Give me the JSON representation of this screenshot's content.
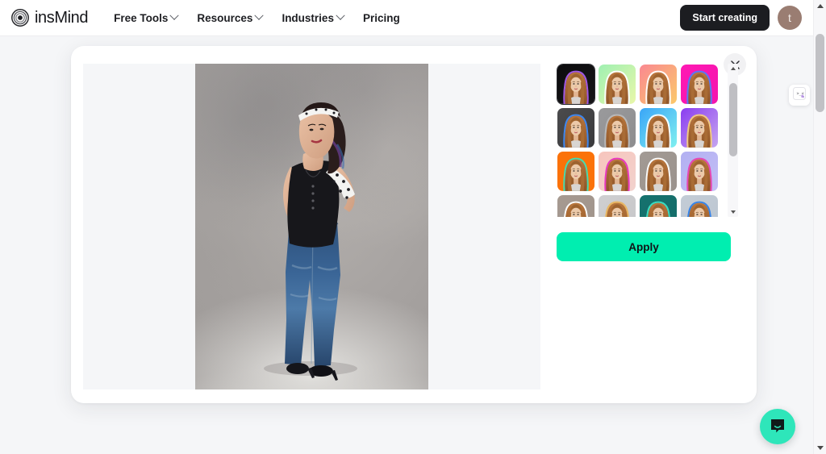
{
  "header": {
    "brand_name": "insMind",
    "logo_icon": "concentric-circles-logo",
    "nav": [
      {
        "label": "Free Tools",
        "has_caret": true
      },
      {
        "label": "Resources",
        "has_caret": true
      },
      {
        "label": "Industries",
        "has_caret": true
      },
      {
        "label": "Pricing",
        "has_caret": false
      }
    ],
    "start_creating_label": "Start creating",
    "avatar_initial": "t",
    "avatar_color": "#9a7d72"
  },
  "modal": {
    "close_icon": "close-icon",
    "canvas": {
      "background": "#f5f6f8",
      "photo_alt": "Full-body studio portrait of a woman in a polka-dot headscarf, black tank top and blue jeans standing against a mottled gray backdrop"
    },
    "style_panel": {
      "apply_label": "Apply",
      "apply_color": "#00eeb0",
      "selected_index": 0,
      "scrollbar": {
        "up_icon": "chevron-up-icon",
        "down_icon": "chevron-down-icon",
        "thumb_position_percent": 7,
        "thumb_size_percent": 55
      },
      "thumbnails": [
        {
          "name": "black-purple-rim",
          "bg": "#0b0b0d",
          "bg2": "#171619",
          "rim": "#a95cf0",
          "selected": true
        },
        {
          "name": "mint-green-gradient",
          "bg": "#9ff0b2",
          "bg2": "#e9f7a9",
          "rim": "#ffffff",
          "selected": false
        },
        {
          "name": "coral-peach-gradient",
          "bg": "#fa8891",
          "bg2": "#fbc96a",
          "rim": "#ffffff",
          "selected": false
        },
        {
          "name": "magenta-blue-rim",
          "bg": "#ff18b4",
          "bg2": "#f315ad",
          "rim": "#4f7dfb",
          "selected": false
        },
        {
          "name": "dark-gray-blue-rim",
          "bg": "#4b4b4d",
          "bg2": "#3a3a3c",
          "rim": "#3d8bfb",
          "selected": false
        },
        {
          "name": "medium-gray",
          "bg": "#9a9a9c",
          "bg2": "#8d8d8f",
          "rim": "#b9b9bb",
          "selected": false
        },
        {
          "name": "sky-cyan-gradient",
          "bg": "#3aa5f7",
          "bg2": "#7ff0f0",
          "rim": "#ffffff",
          "selected": false
        },
        {
          "name": "violet-lavender-gradient",
          "bg": "#8a3df0",
          "bg2": "#c6a6f0",
          "rim": "#f6cf7a",
          "selected": false
        },
        {
          "name": "orange-teal-rim",
          "bg": "#fb7209",
          "bg2": "#fb7209",
          "rim": "#3ce0b8",
          "selected": false
        },
        {
          "name": "light-pink-magenta-rim",
          "bg": "#f7c5bd",
          "bg2": "#f2d2cd",
          "rim": "#e830c0",
          "selected": false
        },
        {
          "name": "taupe-gray",
          "bg": "#a29a94",
          "bg2": "#9b938d",
          "rim": "#ffffff",
          "selected": false
        },
        {
          "name": "periwinkle",
          "bg": "#b2b0f2",
          "bg2": "#c3bef5",
          "rim": "#ea3fb0",
          "selected": false
        },
        {
          "name": "warm-taupe",
          "bg": "#a69a91",
          "bg2": "#a0948b",
          "rim": "#ffffff",
          "selected": false
        },
        {
          "name": "light-gray",
          "bg": "#cfcfd1",
          "bg2": "#c7c7c9",
          "rim": "#e9b45c",
          "selected": false
        },
        {
          "name": "deep-teal",
          "bg": "#15726e",
          "bg2": "#156c69",
          "rim": "#3ce0c5",
          "selected": false
        },
        {
          "name": "pale-blue-gray",
          "bg": "#c3ccd6",
          "bg2": "#bcc6d1",
          "rim": "#2f7fe8",
          "selected": false
        }
      ]
    }
  },
  "side_widget": {
    "icon": "face-sticker-icon"
  },
  "chat": {
    "icon": "chat-bubble-icon",
    "color": "#2ee6ba"
  },
  "browser_scrollbar": {
    "up_icon": "chevron-up-icon",
    "down_icon": "chevron-down-icon",
    "thumb_position_percent": 7
  }
}
